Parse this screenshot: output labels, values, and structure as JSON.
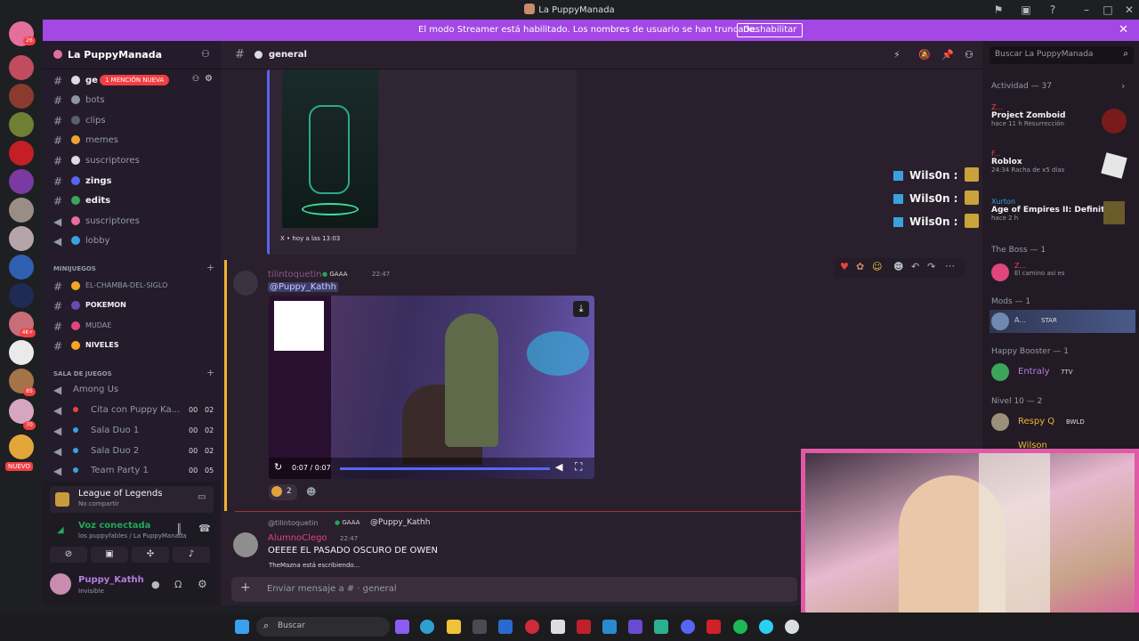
{
  "window": {
    "title": "La PuppyManada"
  },
  "banner": {
    "text": "El modo Streamer está habilitado. Los nombres de usuario se han truncado.",
    "button": "Deshabilitar"
  },
  "guild_badges": [
    "26",
    "4K+",
    "85",
    "70",
    "NUEVO"
  ],
  "server": {
    "name": "La PuppyManada",
    "mention_badge": "1 MENCIÓN NUEVA"
  },
  "channels": [
    {
      "name": "ge",
      "type": "text"
    },
    {
      "name": "bots",
      "type": "text"
    },
    {
      "name": "clips",
      "type": "text"
    },
    {
      "name": "memes",
      "type": "text"
    },
    {
      "name": "suscriptores",
      "type": "text"
    },
    {
      "name": "zings",
      "type": "text"
    },
    {
      "name": "edits",
      "type": "text"
    },
    {
      "name": "suscriptores",
      "type": "voice"
    },
    {
      "name": "lobby",
      "type": "voice"
    }
  ],
  "category_minijuegos": "MINIJUEGOS",
  "minigame_channels": [
    "EL-CHAMBA-DEL-SIGLO",
    "POKEMON",
    "MUDAE",
    "NIVELES"
  ],
  "category_sala": "SALA DE JUEGOS",
  "sala_channels": [
    {
      "name": "Among Us",
      "c1": "",
      "c2": ""
    },
    {
      "name": "Cita con Puppy Ka...",
      "c1": "00",
      "c2": "02"
    },
    {
      "name": "Sala Duo 1",
      "c1": "00",
      "c2": "02"
    },
    {
      "name": "Sala Duo 2",
      "c1": "00",
      "c2": "02"
    },
    {
      "name": "Team Party 1",
      "c1": "00",
      "c2": "05"
    }
  ],
  "activity_game": {
    "title": "League of Legends",
    "sub": "No compartir"
  },
  "voice": {
    "status": "Voz conectada",
    "location": "los puppyfables / La PuppyManada"
  },
  "user": {
    "name": "Puppy_Kathh",
    "status": "Invisible"
  },
  "channel_header": {
    "name": "general"
  },
  "messages": {
    "embed_footer": "X • hoy a las 13:03",
    "winners": [
      "Wils0n :",
      "Wils0n :",
      "Wils0n :"
    ],
    "msg1": {
      "author": "tilintoquetin",
      "tag": "GAAA",
      "time": "22:47",
      "text": "@Puppy_Kathh"
    },
    "video": {
      "time": "0:07 / 0:07"
    },
    "reaction_count": "2",
    "msg2": {
      "reply_author": "@tilintoquetin",
      "reply_tag": "GAAA",
      "reply_text": "@Puppy_Kathh",
      "author": "AlumnoClego",
      "time": "22:47",
      "text": "OEEEE EL PASADO OSCURO DE OWEN"
    },
    "typing": "TheMazna está escribiendo..."
  },
  "composer": {
    "placeholder": "Enviar mensaje a #  · general"
  },
  "search": {
    "placeholder": "Buscar La PuppyManada"
  },
  "members": {
    "activity_header": "Actividad — 37",
    "activities": [
      {
        "user": "Z...",
        "game": "Project Zomboid",
        "detail": "hace 11 h   Resurrección"
      },
      {
        "user": "F...",
        "game": "Roblox",
        "detail": "24:34   Racha de x5 días"
      },
      {
        "user": "Xurton",
        "game": "Age of Empires II: Definitiv...",
        "detail": "hace 2 h"
      }
    ],
    "groups": [
      {
        "header": "The Boss — 1",
        "name": "Z...",
        "sub": "El camino así es"
      },
      {
        "header": "Mods — 1",
        "name": "A...",
        "sub": "STAR"
      },
      {
        "header": "Happy Booster — 1",
        "name": "Entraly",
        "sub": "7TV"
      },
      {
        "header": "Nivel 10 — 2",
        "name": "Respy Q",
        "sub": "BWLD"
      }
    ],
    "last_member": "Wilson"
  },
  "taskbar": {
    "search": "Buscar"
  },
  "colors": {
    "accent": "#a347e5",
    "mention": "#f23f42",
    "link": "#5865f2"
  }
}
